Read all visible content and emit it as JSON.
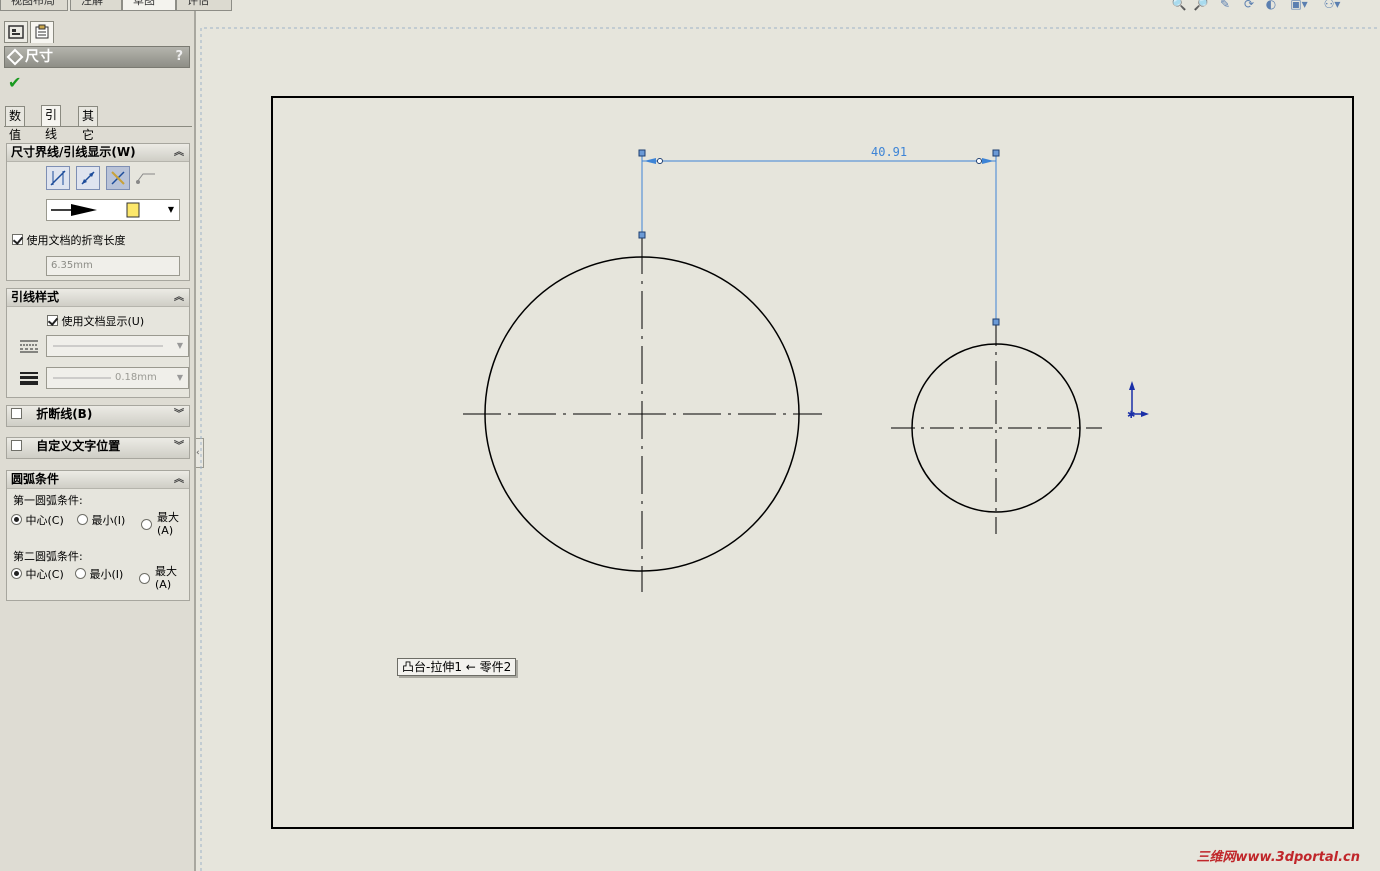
{
  "top_tabs": [
    "视图布局",
    "注解",
    "草图",
    "评估"
  ],
  "panel": {
    "title": "尺寸",
    "help": "?",
    "ok_icon": "check-icon",
    "subtabs": [
      "数值",
      "引线",
      "其它"
    ],
    "witness_group": {
      "title": "尺寸界线/引线显示(W)",
      "use_doc_bend": "使用文档的折弯长度",
      "bend_length": "6.35mm"
    },
    "leader_style": {
      "title": "引线样式",
      "use_doc_display": "使用文档显示(U)",
      "thickness": "0.18mm"
    },
    "break_lines": {
      "title": "折断线(B)"
    },
    "custom_text": {
      "title": "自定义文字位置"
    },
    "arc": {
      "title": "圆弧条件",
      "first_label": "第一圆弧条件:",
      "second_label": "第二圆弧条件:",
      "center": "中心(C)",
      "min": "最小(I)",
      "max": "最大",
      "max_key": "(A)"
    }
  },
  "drawing": {
    "dimension_value": "40.91",
    "tooltip": "凸台-拉伸1 ← 零件2"
  },
  "watermark": "三维网www.3dportal.cn",
  "colors": {
    "dimension": "#3d84d6",
    "accent": "#1a9a20"
  }
}
